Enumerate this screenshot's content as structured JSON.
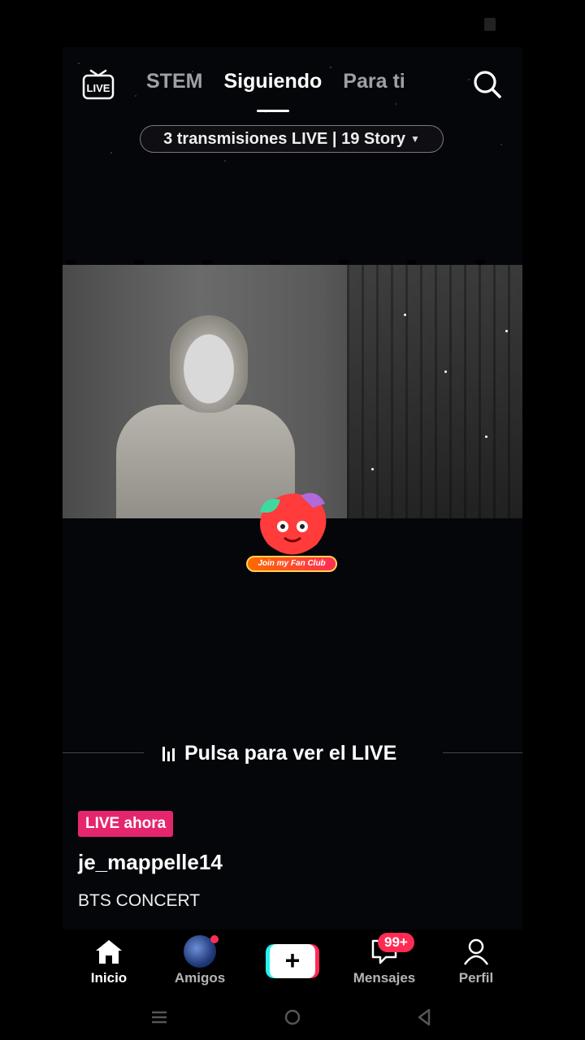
{
  "header": {
    "live_icon_label": "LIVE",
    "tabs": [
      {
        "label": "STEM",
        "active": false
      },
      {
        "label": "Siguiendo",
        "active": true
      },
      {
        "label": "Para ti",
        "active": false
      }
    ]
  },
  "live_summary_pill": "3 transmisiones LIVE | 19 Story",
  "fan_club_label": "Join my Fan Club",
  "tap_prompt": "Pulsa para ver el LIVE",
  "post": {
    "live_badge": "LIVE ahora",
    "username": "je_mappelle14",
    "caption": "BTS CONCERT"
  },
  "bottom_nav": {
    "items": [
      {
        "label": "Inicio",
        "icon": "home-icon",
        "active": true
      },
      {
        "label": "Amigos",
        "icon": "friends-avatar",
        "active": false
      },
      {
        "label": "",
        "icon": "plus-icon",
        "active": false
      },
      {
        "label": "Mensajes",
        "icon": "inbox-icon",
        "active": false
      },
      {
        "label": "Perfil",
        "icon": "profile-icon",
        "active": false
      }
    ],
    "messages_badge": "99+"
  },
  "colors": {
    "accent_pink": "#fe2c55",
    "live_badge": "#e5266e",
    "accent_cyan": "#25f4ee"
  }
}
